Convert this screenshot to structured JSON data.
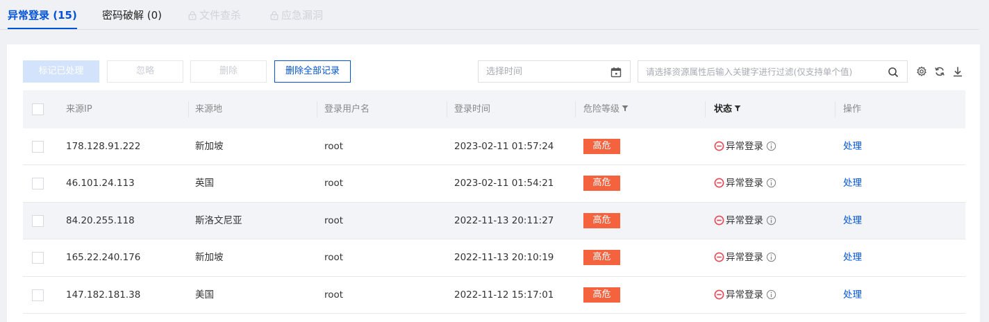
{
  "tabs": [
    {
      "label": "异常登录 (15)",
      "state": "active"
    },
    {
      "label": "密码破解 (0)",
      "state": "normal"
    },
    {
      "label": "文件查杀",
      "state": "disabled",
      "icon": "lock-icon"
    },
    {
      "label": "应急漏洞",
      "state": "disabled",
      "icon": "lock-icon"
    }
  ],
  "toolbar": {
    "mark_label": "标记已处理",
    "ignore_label": "忽略",
    "delete_label": "删除",
    "delete_all_label": "删除全部记录",
    "date_placeholder": "选择时间",
    "search_placeholder": "请选择资源属性后输入关键字进行过滤(仅支持单个值)",
    "icons": [
      "settings-icon",
      "refresh-icon",
      "download-icon"
    ]
  },
  "table": {
    "columns": {
      "ip": "来源IP",
      "location": "来源地",
      "user": "登录用户名",
      "time": "登录时间",
      "risk": "危险等级",
      "status": "状态",
      "ops": "操作"
    },
    "rows": [
      {
        "ip": "178.128.91.222",
        "location": "新加坡",
        "user": "root",
        "time": "2023-02-11 01:57:24",
        "risk": "高危",
        "status": "异常登录",
        "action": "处理"
      },
      {
        "ip": "46.101.24.113",
        "location": "英国",
        "user": "root",
        "time": "2023-02-11 01:54:21",
        "risk": "高危",
        "status": "异常登录",
        "action": "处理"
      },
      {
        "ip": "84.20.255.118",
        "location": "斯洛文尼亚",
        "user": "root",
        "time": "2022-11-13 20:11:27",
        "risk": "高危",
        "status": "异常登录",
        "action": "处理"
      },
      {
        "ip": "165.22.240.176",
        "location": "新加坡",
        "user": "root",
        "time": "2022-11-13 20:10:19",
        "risk": "高危",
        "status": "异常登录",
        "action": "处理"
      },
      {
        "ip": "147.182.181.38",
        "location": "美国",
        "user": "root",
        "time": "2022-11-12 15:17:01",
        "risk": "高危",
        "status": "异常登录",
        "action": "处理"
      }
    ]
  },
  "colors": {
    "accent": "#0052d9",
    "danger_badge": "#f4623e",
    "status_icon": "#e34d59"
  }
}
